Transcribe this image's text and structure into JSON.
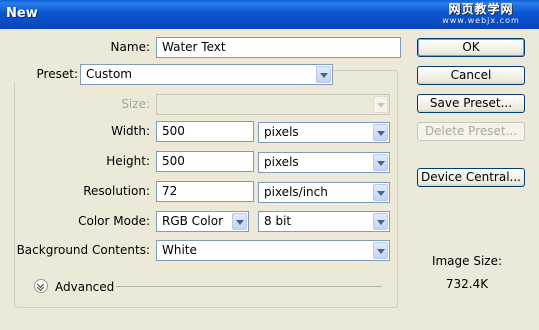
{
  "window": {
    "title": "New",
    "watermark_cn": "网页教学网",
    "watermark_url": "www.webjx.com"
  },
  "name": {
    "label": "Name:",
    "value": "Water Text"
  },
  "preset": {
    "label": "Preset:",
    "value": "Custom"
  },
  "size": {
    "label": "Size:",
    "value": ""
  },
  "width": {
    "label": "Width:",
    "value": "500",
    "unit": "pixels"
  },
  "height": {
    "label": "Height:",
    "value": "500",
    "unit": "pixels"
  },
  "resolution": {
    "label": "Resolution:",
    "value": "72",
    "unit": "pixels/inch"
  },
  "color_mode": {
    "label": "Color Mode:",
    "mode": "RGB Color",
    "depth": "8 bit"
  },
  "background": {
    "label": "Background Contents:",
    "value": "White"
  },
  "advanced": {
    "label": "Advanced"
  },
  "buttons": {
    "ok": "OK",
    "cancel": "Cancel",
    "save_preset": "Save Preset...",
    "delete_preset": "Delete Preset...",
    "device_central": "Device Central..."
  },
  "image_size": {
    "label": "Image Size:",
    "value": "732.4K"
  }
}
